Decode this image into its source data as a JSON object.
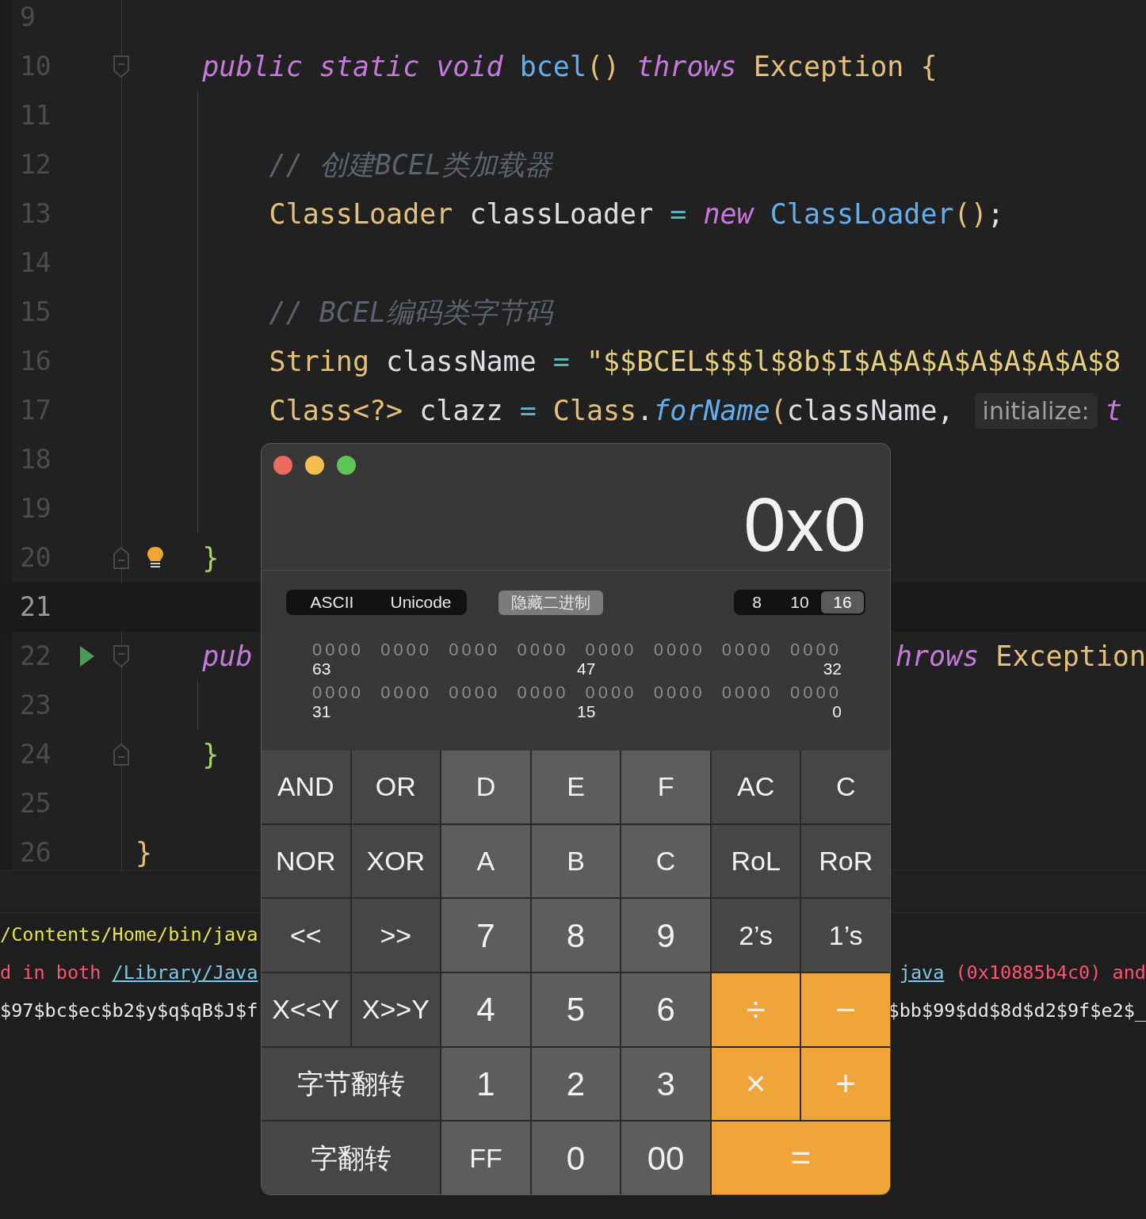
{
  "editor": {
    "lines": [
      {
        "number": "9",
        "current": false
      },
      {
        "number": "10",
        "current": false,
        "fold_start": true,
        "parts": [
          {
            "kind": "code",
            "segments": [
              {
                "text": "    public static void ",
                "kind": "keyword"
              },
              {
                "text": "bcel",
                "kind": "method"
              },
              {
                "text": "()",
                "kind": "paren"
              },
              {
                "text": " throws",
                "kind": "keyword"
              },
              {
                "text": " Exception",
                "kind": "type"
              },
              {
                "text": " {",
                "kind": "brace"
              }
            ]
          }
        ]
      },
      {
        "number": "11",
        "current": false,
        "guide": true
      },
      {
        "number": "12",
        "current": false,
        "guide": true,
        "parts": [
          {
            "kind": "code",
            "segments": [
              {
                "text": "        // 创建BCEL类加载器",
                "kind": "comment"
              }
            ]
          }
        ]
      },
      {
        "number": "13",
        "current": false,
        "guide": true,
        "parts": [
          {
            "kind": "code",
            "segments": [
              {
                "text": "        ClassLoader",
                "kind": "type"
              },
              {
                "text": " classLoader ",
                "kind": "plain"
              },
              {
                "text": "=",
                "kind": "op"
              },
              {
                "text": " new",
                "kind": "keyword"
              },
              {
                "text": " ClassLoader",
                "kind": "method"
              },
              {
                "text": "()",
                "kind": "paren"
              },
              {
                "text": ";",
                "kind": "plain"
              }
            ]
          }
        ]
      },
      {
        "number": "14",
        "current": false,
        "guide": true
      },
      {
        "number": "15",
        "current": false,
        "guide": true,
        "parts": [
          {
            "kind": "code",
            "segments": [
              {
                "text": "        // BCEL编码类字节码",
                "kind": "comment"
              }
            ]
          }
        ]
      },
      {
        "number": "16",
        "current": false,
        "guide": true,
        "parts": [
          {
            "kind": "code",
            "segments": [
              {
                "text": "        String",
                "kind": "type"
              },
              {
                "text": " className ",
                "kind": "plain"
              },
              {
                "text": "=",
                "kind": "op"
              },
              {
                "text": " \"$$BCEL$$$l$8b$I$A$A$A$A$A$A$A$8",
                "kind": "string"
              }
            ]
          }
        ]
      },
      {
        "number": "17",
        "current": false,
        "guide": true,
        "parts": [
          {
            "kind": "code",
            "segments": [
              {
                "text": "        Class<?>",
                "kind": "type"
              },
              {
                "text": " clazz ",
                "kind": "plain"
              },
              {
                "text": "=",
                "kind": "op"
              },
              {
                "text": " Class",
                "kind": "type"
              },
              {
                "text": ".",
                "kind": "plain"
              },
              {
                "text": "forName",
                "kind": "call"
              },
              {
                "text": "(",
                "kind": "paren"
              },
              {
                "text": "className,",
                "kind": "plain"
              }
            ]
          },
          {
            "kind": "hint",
            "text": "initialize:"
          },
          {
            "kind": "code",
            "segments": [
              {
                "text": "t",
                "kind": "keyword"
              }
            ]
          }
        ]
      },
      {
        "number": "18",
        "current": false,
        "guide": true
      },
      {
        "number": "19",
        "current": false,
        "guide": true
      },
      {
        "number": "20",
        "current": false,
        "fold_end": true,
        "bulb": true,
        "parts": [
          {
            "kind": "code",
            "segments": [
              {
                "text": "    }",
                "kind": "brace2"
              }
            ]
          }
        ]
      },
      {
        "number": "21",
        "current": true
      },
      {
        "number": "22",
        "current": false,
        "fold_start": true,
        "run": true,
        "parts": [
          {
            "kind": "code",
            "segments": [
              {
                "text": "    pub",
                "kind": "keyword"
              }
            ]
          },
          {
            "kind": "gap"
          },
          {
            "kind": "code",
            "segments": [
              {
                "text": "hrows",
                "kind": "keyword"
              },
              {
                "text": " Exception",
                "kind": "type"
              }
            ]
          }
        ]
      },
      {
        "number": "23",
        "current": false,
        "guide": true
      },
      {
        "number": "24",
        "current": false,
        "fold_end": true,
        "parts": [
          {
            "kind": "code",
            "segments": [
              {
                "text": "    }",
                "kind": "brace2"
              }
            ]
          }
        ]
      },
      {
        "number": "25",
        "current": false
      },
      {
        "number": "26",
        "current": false,
        "parts": [
          {
            "kind": "code",
            "segments": [
              {
                "text": "}",
                "kind": "brace"
              }
            ]
          }
        ]
      }
    ]
  },
  "console": {
    "lines": [
      {
        "parts": [
          {
            "kind": "text",
            "segments": [
              {
                "text": "/Contents/Home/bin/java",
                "kind": "path"
              }
            ]
          }
        ]
      },
      {
        "parts": [
          {
            "kind": "text",
            "segments": [
              {
                "text": "d in both ",
                "kind": "error"
              },
              {
                "text": "/Library/Java",
                "kind": "link"
              }
            ]
          },
          {
            "kind": "gap"
          },
          {
            "kind": "text",
            "segments": [
              {
                "text": "java",
                "kind": "link"
              },
              {
                "text": " (0x10885b4c0) and",
                "kind": "error"
              }
            ]
          }
        ]
      },
      {
        "parts": [
          {
            "kind": "text",
            "segments": [
              {
                "text": "$97$bc$ec$b2$y$q$qB$J$f",
                "kind": "plain"
              }
            ]
          },
          {
            "kind": "gap"
          },
          {
            "kind": "text",
            "segments": [
              {
                "text": "$bb$99$dd$8d$d2$9f$e2$_",
                "kind": "plain"
              }
            ]
          }
        ]
      }
    ]
  },
  "calculator": {
    "display": "0x0",
    "encoding": [
      {
        "label": "ASCII"
      },
      {
        "label": "Unicode"
      }
    ],
    "hide_binary_button": "隐藏二进制",
    "base": [
      {
        "label": "8",
        "selected": false
      },
      {
        "label": "10",
        "selected": false
      },
      {
        "label": "16",
        "selected": true
      }
    ],
    "bit_rows": [
      {
        "groups": [
          "0000",
          "0000",
          "0000",
          "0000",
          "0000",
          "0000",
          "0000",
          "0000"
        ],
        "labels": [
          "63",
          "47",
          "32"
        ]
      },
      {
        "groups": [
          "0000",
          "0000",
          "0000",
          "0000",
          "0000",
          "0000",
          "0000",
          "0000"
        ],
        "labels": [
          "31",
          "15",
          "0"
        ]
      }
    ],
    "keys": [
      {
        "label": "AND",
        "kind": "fn"
      },
      {
        "label": "OR",
        "kind": "fn"
      },
      {
        "label": "D",
        "kind": "hex"
      },
      {
        "label": "E",
        "kind": "hex"
      },
      {
        "label": "F",
        "kind": "hex"
      },
      {
        "label": "AC",
        "kind": "fn"
      },
      {
        "label": "C",
        "kind": "fn"
      },
      {
        "label": "NOR",
        "kind": "fn"
      },
      {
        "label": "XOR",
        "kind": "fn"
      },
      {
        "label": "A",
        "kind": "hex"
      },
      {
        "label": "B",
        "kind": "hex"
      },
      {
        "label": "C",
        "kind": "hex"
      },
      {
        "label": "RoL",
        "kind": "fn"
      },
      {
        "label": "RoR",
        "kind": "fn"
      },
      {
        "label": "<<",
        "kind": "fn"
      },
      {
        "label": ">>",
        "kind": "fn"
      },
      {
        "label": "7",
        "kind": "number"
      },
      {
        "label": "8",
        "kind": "number"
      },
      {
        "label": "9",
        "kind": "number"
      },
      {
        "label": "2’s",
        "kind": "fn"
      },
      {
        "label": "1’s",
        "kind": "fn"
      },
      {
        "label": "X<<Y",
        "kind": "fn"
      },
      {
        "label": "X>>Y",
        "kind": "fn"
      },
      {
        "label": "4",
        "kind": "number"
      },
      {
        "label": "5",
        "kind": "number"
      },
      {
        "label": "6",
        "kind": "number"
      },
      {
        "label": "÷",
        "kind": "op"
      },
      {
        "label": "−",
        "kind": "op"
      },
      {
        "label": "字节翻转",
        "kind": "wide-fn"
      },
      {
        "label": "1",
        "kind": "number"
      },
      {
        "label": "2",
        "kind": "number"
      },
      {
        "label": "3",
        "kind": "number"
      },
      {
        "label": "×",
        "kind": "op"
      },
      {
        "label": "+",
        "kind": "op"
      },
      {
        "label": "字翻转",
        "kind": "wide-fn"
      },
      {
        "label": "FF",
        "kind": "hex"
      },
      {
        "label": "0",
        "kind": "number"
      },
      {
        "label": "00",
        "kind": "number"
      },
      {
        "label": "=",
        "kind": "wide-op"
      }
    ]
  }
}
